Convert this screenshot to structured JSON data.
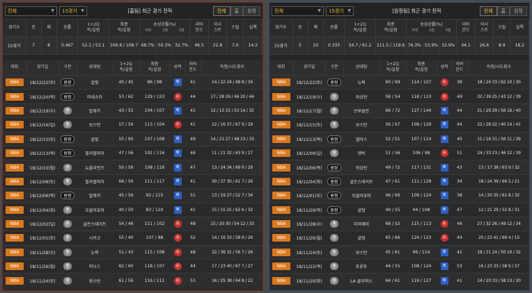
{
  "colors": {
    "league_badge": "#d9791f",
    "win": "#c83232",
    "loss": "#2f5fbf",
    "active_tab": "#f0c030"
  },
  "panels": [
    {
      "side": "home",
      "filter_label": "전체",
      "count_label": "15경기",
      "title": "[홈팀] 최근 경기 전적",
      "tabs": [
        "전체",
        "홈",
        "원정"
      ],
      "summary_headers": [
        "경기수",
        "승",
        "패",
        "승률",
        "1+2Q\n득/실점",
        "최종\n득/실점",
        "슛성공률(%)",
        "리바\n운드",
        "어시\n스트",
        "스틸",
        "실책"
      ],
      "shot_sub": [
        "자유",
        "2점",
        "3점"
      ],
      "summary": {
        "games": "15경기",
        "w": "7",
        "l": "8",
        "pct": "0.467",
        "q12": "52.1 / 53.1",
        "final": "106.8 / 108.7",
        "ft": "68.7%",
        "two": "50.3%",
        "three": "32.7%",
        "reb": "46.5",
        "ast": "22.8",
        "stl": "7.0",
        "tov": "14.2"
      },
      "list_headers": [
        "대회",
        "경기일",
        "구분",
        "상대팀",
        "1+2Q\n득/실점",
        "최종\n득/실점",
        "성적",
        "리바\n운드",
        "득점/시도횟수"
      ],
      "games": [
        {
          "league": "NBA",
          "date": "18/12/22(토)",
          "venue": "원정",
          "vt": "away",
          "opp": "샬럿",
          "q12": "40 / 45",
          "final": "86 / 98",
          "res": "패",
          "rt": "l",
          "reb": "41",
          "fgs": "14 / 22  24 / 48  8 / 34"
        },
        {
          "league": "NBA",
          "date": "18/12/20(목)",
          "venue": "원정",
          "vt": "away",
          "opp": "미네소타",
          "q12": "53 / 62",
          "final": "129 / 123",
          "res": "승",
          "rt": "w",
          "reb": "44",
          "fgs": "17 / 28  26 / 46  20 / 44"
        },
        {
          "league": "NBA",
          "date": "18/12/19(수)",
          "venue": "홈",
          "vt": "home",
          "opp": "밀워키",
          "q12": "43 / 55",
          "final": "104 / 107",
          "res": "패",
          "rt": "l",
          "reb": "41",
          "fgs": "12 / 15  25 / 53  14 / 35"
        },
        {
          "league": "NBA",
          "date": "18/12/16(일)",
          "venue": "홈",
          "vt": "home",
          "opp": "보스턴",
          "q12": "57 / 56",
          "final": "113 / 104",
          "res": "승",
          "rt": "w",
          "reb": "41",
          "fgs": "12 / 16  37 / 67  9 / 29"
        },
        {
          "league": "NBA",
          "date": "18/12/15(토)",
          "venue": "원정",
          "vt": "away",
          "opp": "샬럿",
          "q12": "55 / 60",
          "final": "107 / 108",
          "res": "패",
          "rt": "l",
          "reb": "49",
          "fgs": "14 / 21  27 / 48  13 / 33"
        },
        {
          "league": "NBA",
          "date": "18/12/13(목)",
          "venue": "원정",
          "vt": "away",
          "opp": "필라델피아",
          "q12": "47 / 56",
          "final": "102 / 116",
          "res": "패",
          "rt": "l",
          "reb": "46",
          "fgs": "11 / 21  32 / 63  9 / 27"
        },
        {
          "league": "NBA",
          "date": "18/12/10(월)",
          "venue": "홈",
          "vt": "home",
          "opp": "뉴올리언즈",
          "q12": "50 / 56",
          "final": "108 / 116",
          "res": "패",
          "rt": "l",
          "reb": "47",
          "fgs": "13 / 24  34 / 69  9 / 29"
        },
        {
          "league": "NBA",
          "date": "18/12/08(토)",
          "venue": "홈",
          "vt": "home",
          "opp": "필라델피아",
          "q12": "68 / 56",
          "final": "111 / 117",
          "res": "패",
          "rt": "l",
          "reb": "41",
          "fgs": "30 / 37  30 / 61  7 / 26"
        },
        {
          "league": "NBA",
          "date": "18/12/06(목)",
          "venue": "원정",
          "vt": "away",
          "opp": "밀워키",
          "q12": "45 / 56",
          "final": "92 / 115",
          "res": "패",
          "rt": "l",
          "reb": "51",
          "fgs": "13 / 19  27 / 52  7 / 34"
        },
        {
          "league": "NBA",
          "date": "18/12/04(화)",
          "venue": "홈",
          "vt": "home",
          "opp": "오클라호마",
          "q12": "40 / 50",
          "final": "83 / 110",
          "res": "패",
          "rt": "l",
          "reb": "41",
          "fgs": "15 / 15  25 / 62  6 / 32"
        },
        {
          "league": "NBA",
          "date": "18/12/02(일)",
          "venue": "홈",
          "vt": "home",
          "opp": "골든스테이트",
          "q12": "54 / 46",
          "final": "111 / 102",
          "res": "승",
          "rt": "w",
          "reb": "48",
          "fgs": "15 / 20  30 / 54  12 / 33"
        },
        {
          "league": "NBA",
          "date": "18/12/01(토)",
          "venue": "홈",
          "vt": "home",
          "opp": "시카고",
          "q12": "55 / 40",
          "final": "107 / 88",
          "res": "승",
          "rt": "w",
          "reb": "52",
          "fgs": "14 / 16  33 / 58  9 / 26"
        },
        {
          "league": "NBA",
          "date": "18/11/28(수)",
          "venue": "홈",
          "vt": "home",
          "opp": "뉴욕",
          "q12": "51 / 43",
          "final": "115 / 108",
          "res": "승",
          "rt": "w",
          "reb": "48",
          "fgs": "32 / 36  31 / 56  7 / 26"
        },
        {
          "league": "NBA",
          "date": "18/11/26(월)",
          "venue": "홈",
          "vt": "home",
          "opp": "피닉스",
          "q12": "62 / 60",
          "final": "118 / 107",
          "res": "승",
          "rt": "w",
          "reb": "44",
          "fgs": "17 / 23  40 / 67  7 / 27"
        },
        {
          "league": "NBA",
          "date": "18/11/24(토)",
          "venue": "홈",
          "vt": "home",
          "opp": "휴스턴",
          "q12": "61 / 56",
          "final": "116 / 111",
          "res": "승",
          "rt": "w",
          "reb": "53",
          "fgs": "16 / 25  38 / 64  8 / 22"
        }
      ]
    },
    {
      "side": "away",
      "filter_label": "전체",
      "count_label": "15경기",
      "title": "[원정팀] 최근 경기 전적",
      "tabs": [
        "전체",
        "홈",
        "원정"
      ],
      "summary_headers": [
        "경기수",
        "승",
        "패",
        "승률",
        "1+2Q\n득/실점",
        "최종\n득/실점",
        "슛성공률(%)",
        "리바\n운드",
        "어시\n스트",
        "스틸",
        "실책"
      ],
      "shot_sub": [
        "자유",
        "2점",
        "3점"
      ],
      "summary": {
        "games": "15경기",
        "w": "5",
        "l": "10",
        "pct": "0.333",
        "q12": "54.7 / 61.2",
        "final": "111.5 / 119.6",
        "ft": "76.3%",
        "two": "53.9%",
        "three": "32.9%",
        "reb": "44.1",
        "ast": "26.6",
        "stl": "8.9",
        "tov": "18.2"
      },
      "list_headers": [
        "대회",
        "경기일",
        "구분",
        "상대팀",
        "1+2Q\n득/실점",
        "최종\n득/실점",
        "성적",
        "리바\n운드",
        "득점/시도횟수"
      ],
      "games": [
        {
          "league": "NBA",
          "date": "18/12/22(토)",
          "venue": "원정",
          "vt": "away",
          "opp": "뉴욕",
          "q12": "60 / 69",
          "final": "114 / 107",
          "res": "승",
          "rt": "w",
          "reb": "39",
          "fgs": "18 / 24  33 / 62  10 / 30"
        },
        {
          "league": "NBA",
          "date": "18/12/19(수)",
          "venue": "홈",
          "vt": "home",
          "opp": "워싱턴",
          "q12": "58 / 54",
          "final": "118 / 110",
          "res": "승",
          "rt": "w",
          "reb": "49",
          "fgs": "32 / 39  25 / 43  12 / 39"
        },
        {
          "league": "NBA",
          "date": "18/12/17(월)",
          "venue": "홈",
          "vt": "home",
          "opp": "브루클린",
          "q12": "66 / 72",
          "final": "127 / 144",
          "res": "패",
          "rt": "l",
          "reb": "44",
          "fgs": "21 / 29  29 / 56  16 / 40"
        },
        {
          "league": "NBA",
          "date": "18/12/15(토)",
          "venue": "홈",
          "vt": "home",
          "opp": "보스턴",
          "q12": "56 / 67",
          "final": "108 / 129",
          "res": "패",
          "rt": "l",
          "reb": "44",
          "fgs": "22 / 28  22 / 40  14 / 41"
        },
        {
          "league": "NBA",
          "date": "18/12/13(목)",
          "venue": "원정",
          "vt": "away",
          "opp": "댈러스",
          "q12": "52 / 51",
          "final": "107 / 114",
          "res": "패",
          "rt": "l",
          "reb": "45",
          "fgs": "11 / 16  31 / 56  11 / 39"
        },
        {
          "league": "NBA",
          "date": "18/12/09(일)",
          "venue": "홈",
          "vt": "home",
          "opp": "덴버",
          "q12": "51 / 56",
          "final": "106 / 98",
          "res": "승",
          "rt": "w",
          "reb": "51",
          "fgs": "24 / 33  23 / 46  12 / 39"
        },
        {
          "league": "NBA",
          "date": "18/12/06(목)",
          "venue": "원정",
          "vt": "away",
          "opp": "워싱턴",
          "q12": "49 / 72",
          "final": "117 / 131",
          "res": "패",
          "rt": "l",
          "reb": "43",
          "fgs": "13 / 17  38 / 63  9 / 32"
        },
        {
          "league": "NBA",
          "date": "18/12/04(화)",
          "venue": "원정",
          "vt": "away",
          "opp": "골든스테이트",
          "q12": "47 / 61",
          "final": "111 / 128",
          "res": "패",
          "rt": "l",
          "reb": "34",
          "fgs": "18 / 24  39 / 66  5 / 21"
        },
        {
          "league": "NBA",
          "date": "18/12/01(토)",
          "venue": "원정",
          "vt": "away",
          "opp": "오클라호마",
          "q12": "46 / 66",
          "final": "109 / 124",
          "res": "패",
          "rt": "l",
          "reb": "38",
          "fgs": "14 / 20  35 / 61  8 / 32"
        },
        {
          "league": "NBA",
          "date": "18/11/29(목)",
          "venue": "원정",
          "vt": "away",
          "opp": "샬럿",
          "q12": "49 / 55",
          "final": "94 / 108",
          "res": "패",
          "rt": "l",
          "reb": "47",
          "fgs": "12 / 21  29 / 52  8 / 31"
        },
        {
          "league": "NBA",
          "date": "18/11/28(수)",
          "venue": "홈",
          "vt": "home",
          "opp": "마이애미",
          "q12": "68 / 52",
          "final": "115 / 113",
          "res": "승",
          "rt": "w",
          "reb": "46",
          "fgs": "27 / 32  26 / 49  12 / 34"
        },
        {
          "league": "NBA",
          "date": "18/11/26(월)",
          "venue": "홈",
          "vt": "home",
          "opp": "샬럿",
          "q12": "65 / 66",
          "final": "124 / 123",
          "res": "승",
          "rt": "w",
          "reb": "44",
          "fgs": "20 / 23  41 / 69  4 / 15"
        },
        {
          "league": "NBA",
          "date": "18/11/24(토)",
          "venue": "홈",
          "vt": "home",
          "opp": "보스턴",
          "q12": "45 / 61",
          "final": "96 / 114",
          "res": "패",
          "rt": "l",
          "reb": "41",
          "fgs": "18 / 21  24 / 50  10 / 32"
        },
        {
          "league": "NBA",
          "date": "18/11/22(목)",
          "venue": "홈",
          "vt": "home",
          "opp": "토론토",
          "q12": "44 / 55",
          "final": "108 / 124",
          "res": "패",
          "rt": "l",
          "reb": "53",
          "fgs": "16 / 23  33 / 58  9 / 37"
        },
        {
          "league": "NBA",
          "date": "18/11/20(화)",
          "venue": "홈",
          "vt": "home",
          "opp": "LA 클리퍼스",
          "q12": "64 / 61",
          "final": "119 / 127",
          "res": "패",
          "rt": "l",
          "reb": "41",
          "fgs": "14 / 20  33 / 58  13 / 30"
        }
      ]
    }
  ]
}
